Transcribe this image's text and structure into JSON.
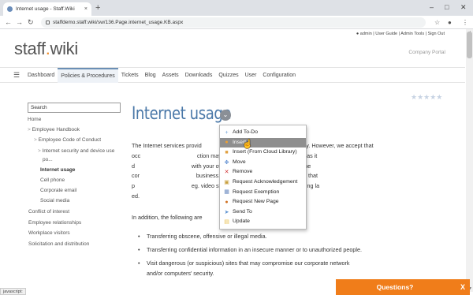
{
  "browser": {
    "tab_title": "Internet usage - Staff.Wiki",
    "tab_close": "×",
    "new_tab": "+",
    "url": "staffdemo.staff.wiki/sw/136.Page.internet_usage.KB.aspx",
    "status_text": "javascript:"
  },
  "header": {
    "top_links": "admin | User Guide | Admin Tools | Sign Out",
    "logo_main": "staff",
    "logo_dot": ".",
    "logo_end": "wiki",
    "portal": "Company Portal"
  },
  "nav": {
    "items": [
      "Dashboard",
      "Policies & Procedures",
      "Tickets",
      "Blog",
      "Assets",
      "Downloads",
      "Quizzes",
      "User",
      "Configuration"
    ],
    "active_index": 1
  },
  "sidebar": {
    "search_value": "Search",
    "items": [
      {
        "label": "Home",
        "prefix": ""
      },
      {
        "label": "Employee Handbook",
        "prefix": "> "
      },
      {
        "label": "Employee Code of Conduct",
        "prefix": "> "
      },
      {
        "label": "Internet security and device use",
        "prefix": "> "
      },
      {
        "label": "po...",
        "prefix": ""
      },
      {
        "label": "Internet usage",
        "prefix": ""
      },
      {
        "label": "Cell phone",
        "prefix": ""
      },
      {
        "label": "Corporate email",
        "prefix": ""
      },
      {
        "label": "Social media",
        "prefix": ""
      },
      {
        "label": "Conflict of interest",
        "prefix": ""
      },
      {
        "label": "Employee relationships",
        "prefix": ""
      },
      {
        "label": "Workplace visitors",
        "prefix": ""
      },
      {
        "label": "Solicitation and distribution",
        "prefix": ""
      }
    ]
  },
  "rating": {
    "stars": "★★★★★",
    "value": 0,
    "max": 5
  },
  "content": {
    "title": "Internet usage",
    "paragraph1": "The Internet services provid           business use only. However, we accept that occ          ction may be used for personal use so long as it d          with your own duties or impact the ability for the cor          business. This means that any personal use that p          eg. video streams and uploading or downloading la          ed.",
    "paragraph2": "In addition, the following are",
    "bullets": [
      "Transferring obscene, offensive or illegal media.",
      "Transferring confidential information in an insecure manner or to unauthorized people.",
      "Visit dangerous (or suspicious) sites that may compromise our corporate network and/or computers' security."
    ]
  },
  "context_menu": {
    "items": [
      {
        "label": "Add To-Do",
        "icon": "add-todo-icon",
        "color": "#6fa0d8"
      },
      {
        "label": "Insert",
        "icon": "insert-icon",
        "color": "#f0a030"
      },
      {
        "label": "Insert (From Cloud Library)",
        "icon": "cloud-library-icon",
        "color": "#e0a040"
      },
      {
        "label": "Move",
        "icon": "move-icon",
        "color": "#5a8ad0"
      },
      {
        "label": "Remove",
        "icon": "remove-icon",
        "color": "#d03030"
      },
      {
        "label": "Request Acknowledgement",
        "icon": "acknowledgement-icon",
        "color": "#c8a040"
      },
      {
        "label": "Request Exemption",
        "icon": "exemption-icon",
        "color": "#6a8ac0"
      },
      {
        "label": "Request New Page",
        "icon": "new-page-icon",
        "color": "#d07020"
      },
      {
        "label": "Send To",
        "icon": "send-to-icon",
        "color": "#5a90d0"
      },
      {
        "label": "Update",
        "icon": "update-icon",
        "color": "#e8c050"
      }
    ],
    "highlighted_index": 1
  },
  "questions_widget": {
    "label": "Questions?",
    "close": "X",
    "color": "#f07d1a"
  },
  "colors": {
    "accent": "#4a78a8",
    "logo_dot": "#f08a24"
  }
}
